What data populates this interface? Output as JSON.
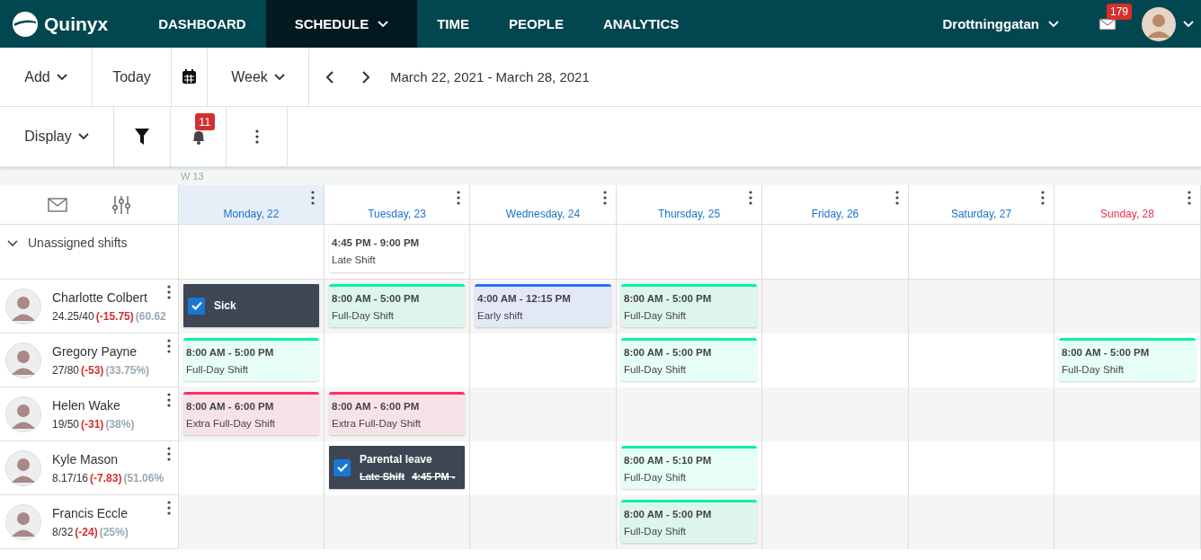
{
  "nav": {
    "logo": "Quinyx",
    "items": [
      {
        "label": "DASHBOARD",
        "selected": false,
        "dropdown": false
      },
      {
        "label": "SCHEDULE",
        "selected": true,
        "dropdown": true
      },
      {
        "label": "TIME",
        "selected": false,
        "dropdown": false
      },
      {
        "label": "PEOPLE",
        "selected": false,
        "dropdown": false
      },
      {
        "label": "ANALYTICS",
        "selected": false,
        "dropdown": false
      }
    ],
    "location": "Drottninggatan",
    "mail_count": "179"
  },
  "toolbar": {
    "add": "Add",
    "today": "Today",
    "view": "Week",
    "date_range": "March 22, 2021 - March 28, 2021",
    "display": "Display",
    "alert_count": "11"
  },
  "week_label": "W 13",
  "days": [
    {
      "label": "Monday, 22",
      "selected": true,
      "kind": "weekday"
    },
    {
      "label": "Tuesday, 23",
      "selected": false,
      "kind": "weekday"
    },
    {
      "label": "Wednesday, 24",
      "selected": false,
      "kind": "weekday"
    },
    {
      "label": "Thursday, 25",
      "selected": false,
      "kind": "weekday"
    },
    {
      "label": "Friday, 26",
      "selected": false,
      "kind": "weekday"
    },
    {
      "label": "Saturday, 27",
      "selected": false,
      "kind": "weekday"
    },
    {
      "label": "Sunday, 28",
      "selected": false,
      "kind": "sunday"
    }
  ],
  "unassigned": {
    "label": "Unassigned shifts",
    "expanded": true,
    "cells": [
      {},
      {
        "shift": {
          "kind": "open",
          "time": "4:45 PM - 9:00 PM",
          "name": "Late Shift"
        }
      },
      {},
      {},
      {},
      {},
      {}
    ]
  },
  "employees": [
    {
      "name": "Charlotte Colbert",
      "hours": "24.25/40",
      "diff": "(-15.75)",
      "percent": "(60.62",
      "cells": [
        {
          "shift": {
            "kind": "absence",
            "title": "Sick",
            "checked": true
          }
        },
        {
          "shift": {
            "kind": "shift",
            "color": "#00f59b",
            "time": "8:00 AM - 5:00 PM",
            "name": "Full-Day Shift"
          }
        },
        {
          "shift": {
            "kind": "shift",
            "color": "#2e6ef7",
            "time": "4:00 AM - 12:15 PM",
            "name": "Early shift"
          }
        },
        {
          "shift": {
            "kind": "shift",
            "color": "#00f59b",
            "time": "8:00 AM - 5:00 PM",
            "name": "Full-Day Shift"
          }
        },
        {},
        {},
        {}
      ]
    },
    {
      "name": "Gregory Payne",
      "hours": "27/80",
      "diff": "(-53)",
      "percent": "(33.75%)",
      "cells": [
        {
          "shift": {
            "kind": "shift",
            "color": "#00f59b",
            "time": "8:00 AM - 5:00 PM",
            "name": "Full-Day Shift"
          }
        },
        {},
        {},
        {
          "shift": {
            "kind": "shift",
            "color": "#00f59b",
            "time": "8:00 AM - 5:00 PM",
            "name": "Full-Day Shift"
          }
        },
        {},
        {},
        {
          "shift": {
            "kind": "shift",
            "color": "#00f59b",
            "time": "8:00 AM - 5:00 PM",
            "name": "Full-Day Shift"
          }
        }
      ]
    },
    {
      "name": "Helen Wake",
      "hours": "19/50",
      "diff": "(-31)",
      "percent": "(38%)",
      "cells": [
        {
          "shift": {
            "kind": "shift",
            "color": "#ff2e63",
            "time": "8:00 AM - 6:00 PM",
            "name": "Extra Full-Day Shift"
          }
        },
        {
          "shift": {
            "kind": "shift",
            "color": "#ff2e63",
            "time": "8:00 AM - 6:00 PM",
            "name": "Extra Full-Day Shift"
          }
        },
        {},
        {},
        {},
        {},
        {}
      ]
    },
    {
      "name": "Kyle Mason",
      "hours": "8.17/16",
      "diff": "(-7.83)",
      "percent": "(51.06%",
      "cells": [
        {},
        {
          "shift": {
            "kind": "absence",
            "title": "Parental leave",
            "checked": true,
            "struck_name": "Late Shift",
            "struck_time": "4:45 PM -"
          }
        },
        {},
        {
          "shift": {
            "kind": "shift",
            "color": "#00f59b",
            "time": "8:00 AM - 5:10 PM",
            "name": "Full-Day Shift"
          }
        },
        {},
        {},
        {}
      ]
    },
    {
      "name": "Francis Eccle",
      "hours": "8/32",
      "diff": "(-24)",
      "percent": "(25%)",
      "cells": [
        {},
        {},
        {},
        {
          "shift": {
            "kind": "shift",
            "color": "#00f59b",
            "time": "8:00 AM - 5:00 PM",
            "name": "Full-Day Shift"
          }
        },
        {},
        {},
        {}
      ]
    }
  ]
}
